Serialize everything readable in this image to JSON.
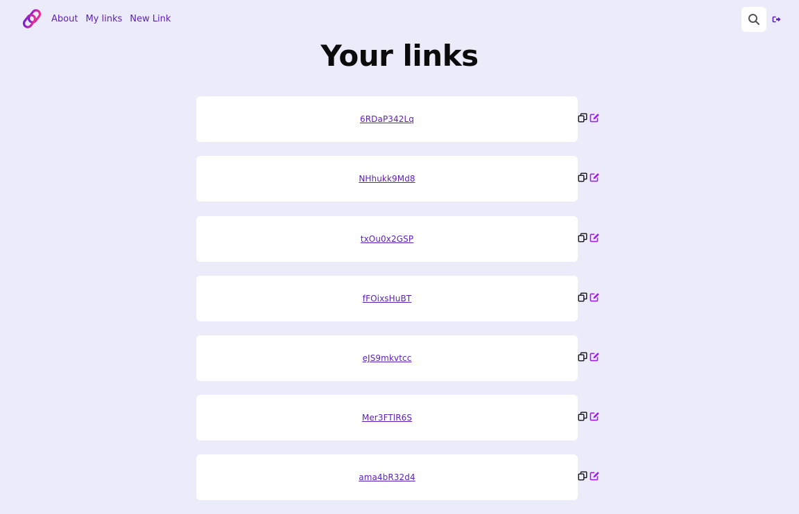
{
  "nav": {
    "links": [
      {
        "label": "About"
      },
      {
        "label": "My links"
      },
      {
        "label": "New Link"
      }
    ],
    "logo_icon": "chain-link-logo",
    "search_icon": "search-icon",
    "logout_icon": "logout-icon"
  },
  "page": {
    "title": "Your links"
  },
  "links": [
    {
      "code": "6RDaP342Lq"
    },
    {
      "code": "NHhukk9Md8"
    },
    {
      "code": "txOu0x2GSP"
    },
    {
      "code": "fFOixsHuBT"
    },
    {
      "code": "eJS9mkvtcc"
    },
    {
      "code": "Mer3FTlR6S"
    },
    {
      "code": "ama4bR32d4"
    }
  ],
  "colors": {
    "accent": "#5a1fb8",
    "edit_icon": "#a020f0",
    "logo_gradient_start": "#ff2f8a",
    "logo_gradient_end": "#6a1cd8",
    "background": "#ecebf9"
  }
}
